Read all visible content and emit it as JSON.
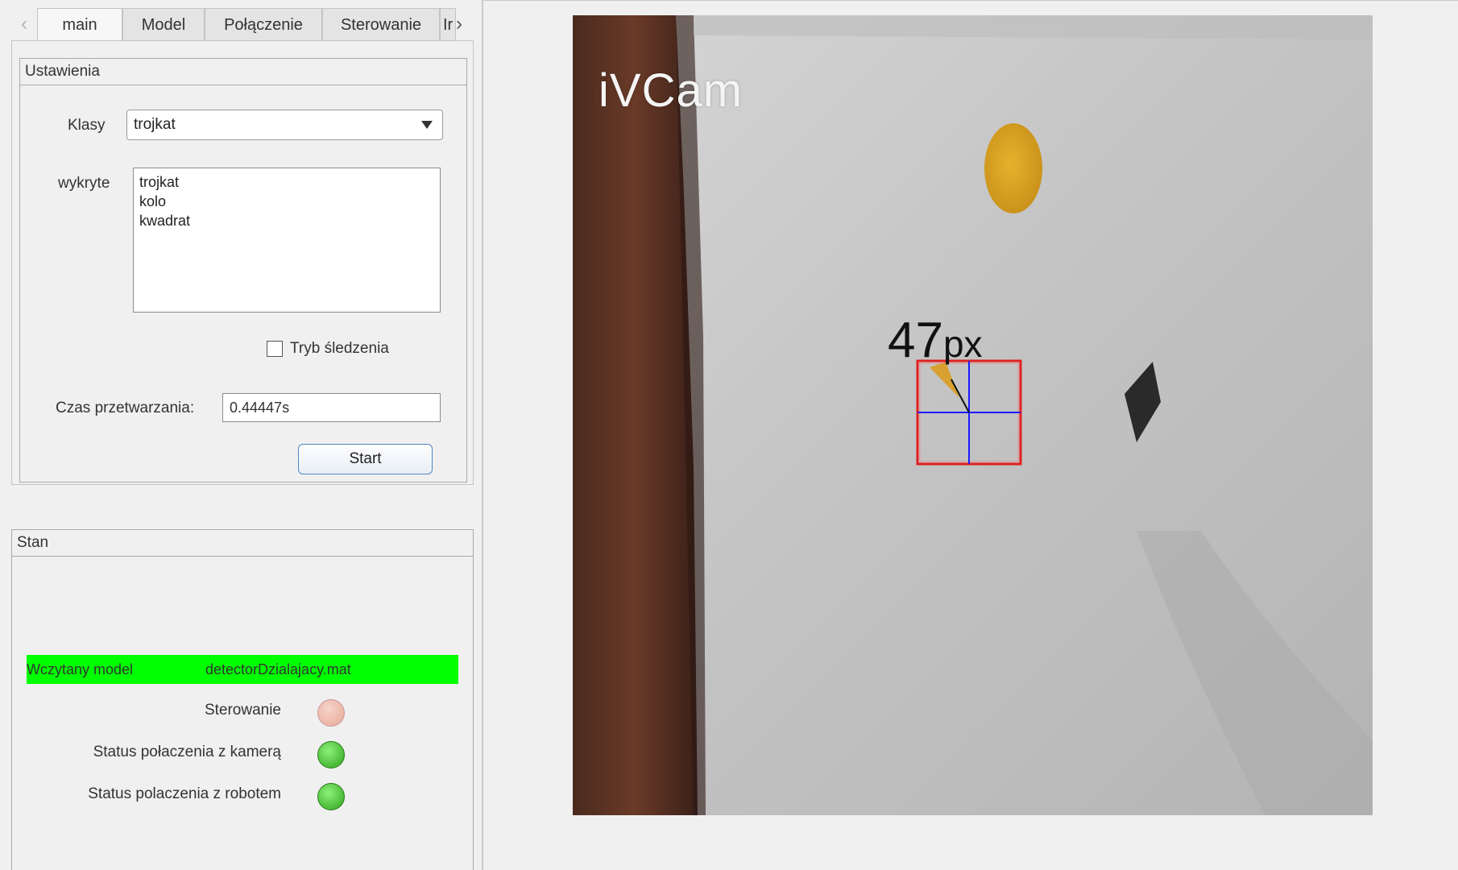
{
  "tabs": {
    "items": [
      "main",
      "Model",
      "Połączenie",
      "Sterowanie",
      "Ir"
    ],
    "active": "main"
  },
  "settings": {
    "title": "Ustawienia",
    "classes_label": "Klasy",
    "classes_value": "trojkat",
    "detected_label": "wykryte",
    "detected_items": [
      "trojkat",
      "kolo",
      "kwadrat"
    ],
    "tracking_label": "Tryb śledzenia",
    "tracking_checked": false,
    "processing_label": "Czas przetwarzania:",
    "processing_value": "0.44447s",
    "start_label": "Start"
  },
  "status": {
    "title": "Stan",
    "model_label": "Wczytany model",
    "model_value": "detectorDzialajacy.mat",
    "model_bar_color": "#00ff00",
    "lamps": [
      {
        "label": "Sterowanie",
        "state": "pink"
      },
      {
        "label": "Status połaczenia z kamerą",
        "state": "green"
      },
      {
        "label": "Status polaczenia z robotem",
        "state": "green"
      }
    ]
  },
  "camera": {
    "watermark": "iVCam",
    "distance_value": "47",
    "distance_unit": "px",
    "box_color": "#e02020",
    "crosshair_color": "#1a1aff"
  }
}
